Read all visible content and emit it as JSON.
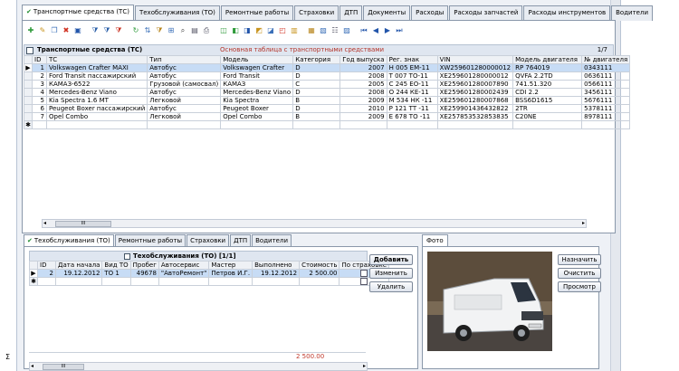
{
  "tabs": [
    "Транспортные средства (ТС)",
    "Техобслуживания (ТО)",
    "Ремонтные работы",
    "Страховки",
    "ДТП",
    "Документы",
    "Расходы",
    "Расходы запчастей",
    "Расходы инструментов",
    "Водители"
  ],
  "main_grid": {
    "title": "Транспортные средства (ТС)",
    "subtitle": "Основная таблица с транспортными средствами",
    "page": "1/7",
    "columns": [
      "ID",
      "ТС",
      "Тип",
      "Модель",
      "Категория",
      "Год выпуска",
      "Рег. знак",
      "VIN",
      "Модель двигателя",
      "№ двигателя"
    ],
    "rows": [
      [
        "1",
        "Volkswagen Crafter MAXI",
        "Автобус",
        "Volkswagen Crafter",
        "D",
        "2007",
        "Н 005 ЕМ-11",
        "XW259601280000012",
        "RP 764019",
        "0343111"
      ],
      [
        "2",
        "Ford Transit пассажирский",
        "Автобус",
        "Ford Transit",
        "D",
        "2008",
        "Т 007 ТО-11",
        "XE259601280000012",
        "QVFA 2.2TD",
        "0636111"
      ],
      [
        "3",
        "КАМАЗ-6522",
        "Грузовой (самосвал)",
        "КАМАЗ",
        "C",
        "2005",
        "С 245 ЕО-11",
        "XE259601280007890",
        "741.51.320",
        "0566111"
      ],
      [
        "4",
        "Mercedes-Benz Viano",
        "Автобус",
        "Mercedes-Benz Viano",
        "D",
        "2008",
        "О 244 КЕ-11",
        "XE259601280002439",
        "CDI 2.2",
        "3456111"
      ],
      [
        "5",
        "Kia Spectra 1.6 MT",
        "Легковой",
        "Kia Spectra",
        "B",
        "2009",
        "М 534 НК -11",
        "XE259601280007868",
        "BSS6D1615",
        "5676111"
      ],
      [
        "6",
        "Peugeot Boxer пассажирский",
        "Автобус",
        "Peugeot Boxer",
        "D",
        "2010",
        "Р 121 ТТ -11",
        "XE259901436432822",
        "2TR",
        "5378111"
      ],
      [
        "7",
        "Opel Combo",
        "Легковой",
        "Opel Combo",
        "B",
        "2009",
        "Е 678 ТО -11",
        "XE257853532853835",
        "C20NE",
        "8978111"
      ]
    ]
  },
  "lower_tabs": [
    "Техобслуживания (ТО)",
    "Ремонтные работы",
    "Страховки",
    "ДТП",
    "Водители"
  ],
  "sub_grid": {
    "title": "Техобслуживания (ТО) [1/1]",
    "columns": [
      "ID",
      "Дата начала",
      "Вид ТО",
      "Пробег",
      "Автосервис",
      "Мастер",
      "Выполнено",
      "Стоимость",
      "По страховке"
    ],
    "rows": [
      [
        "2",
        "19.12.2012",
        "ТО 1",
        "49678",
        "\"АвтоРемонт\"",
        "Петров И.Г.",
        "19.12.2012",
        "2 500.00",
        ""
      ]
    ],
    "total": "2 500.00",
    "sigma": "Σ"
  },
  "sub_buttons": [
    "Добавить",
    "Изменить",
    "Удалить"
  ],
  "photo_tab": "Фото",
  "photo_buttons": [
    "Назначить",
    "Очистить",
    "Просмотр"
  ],
  "scroll_label": "III"
}
